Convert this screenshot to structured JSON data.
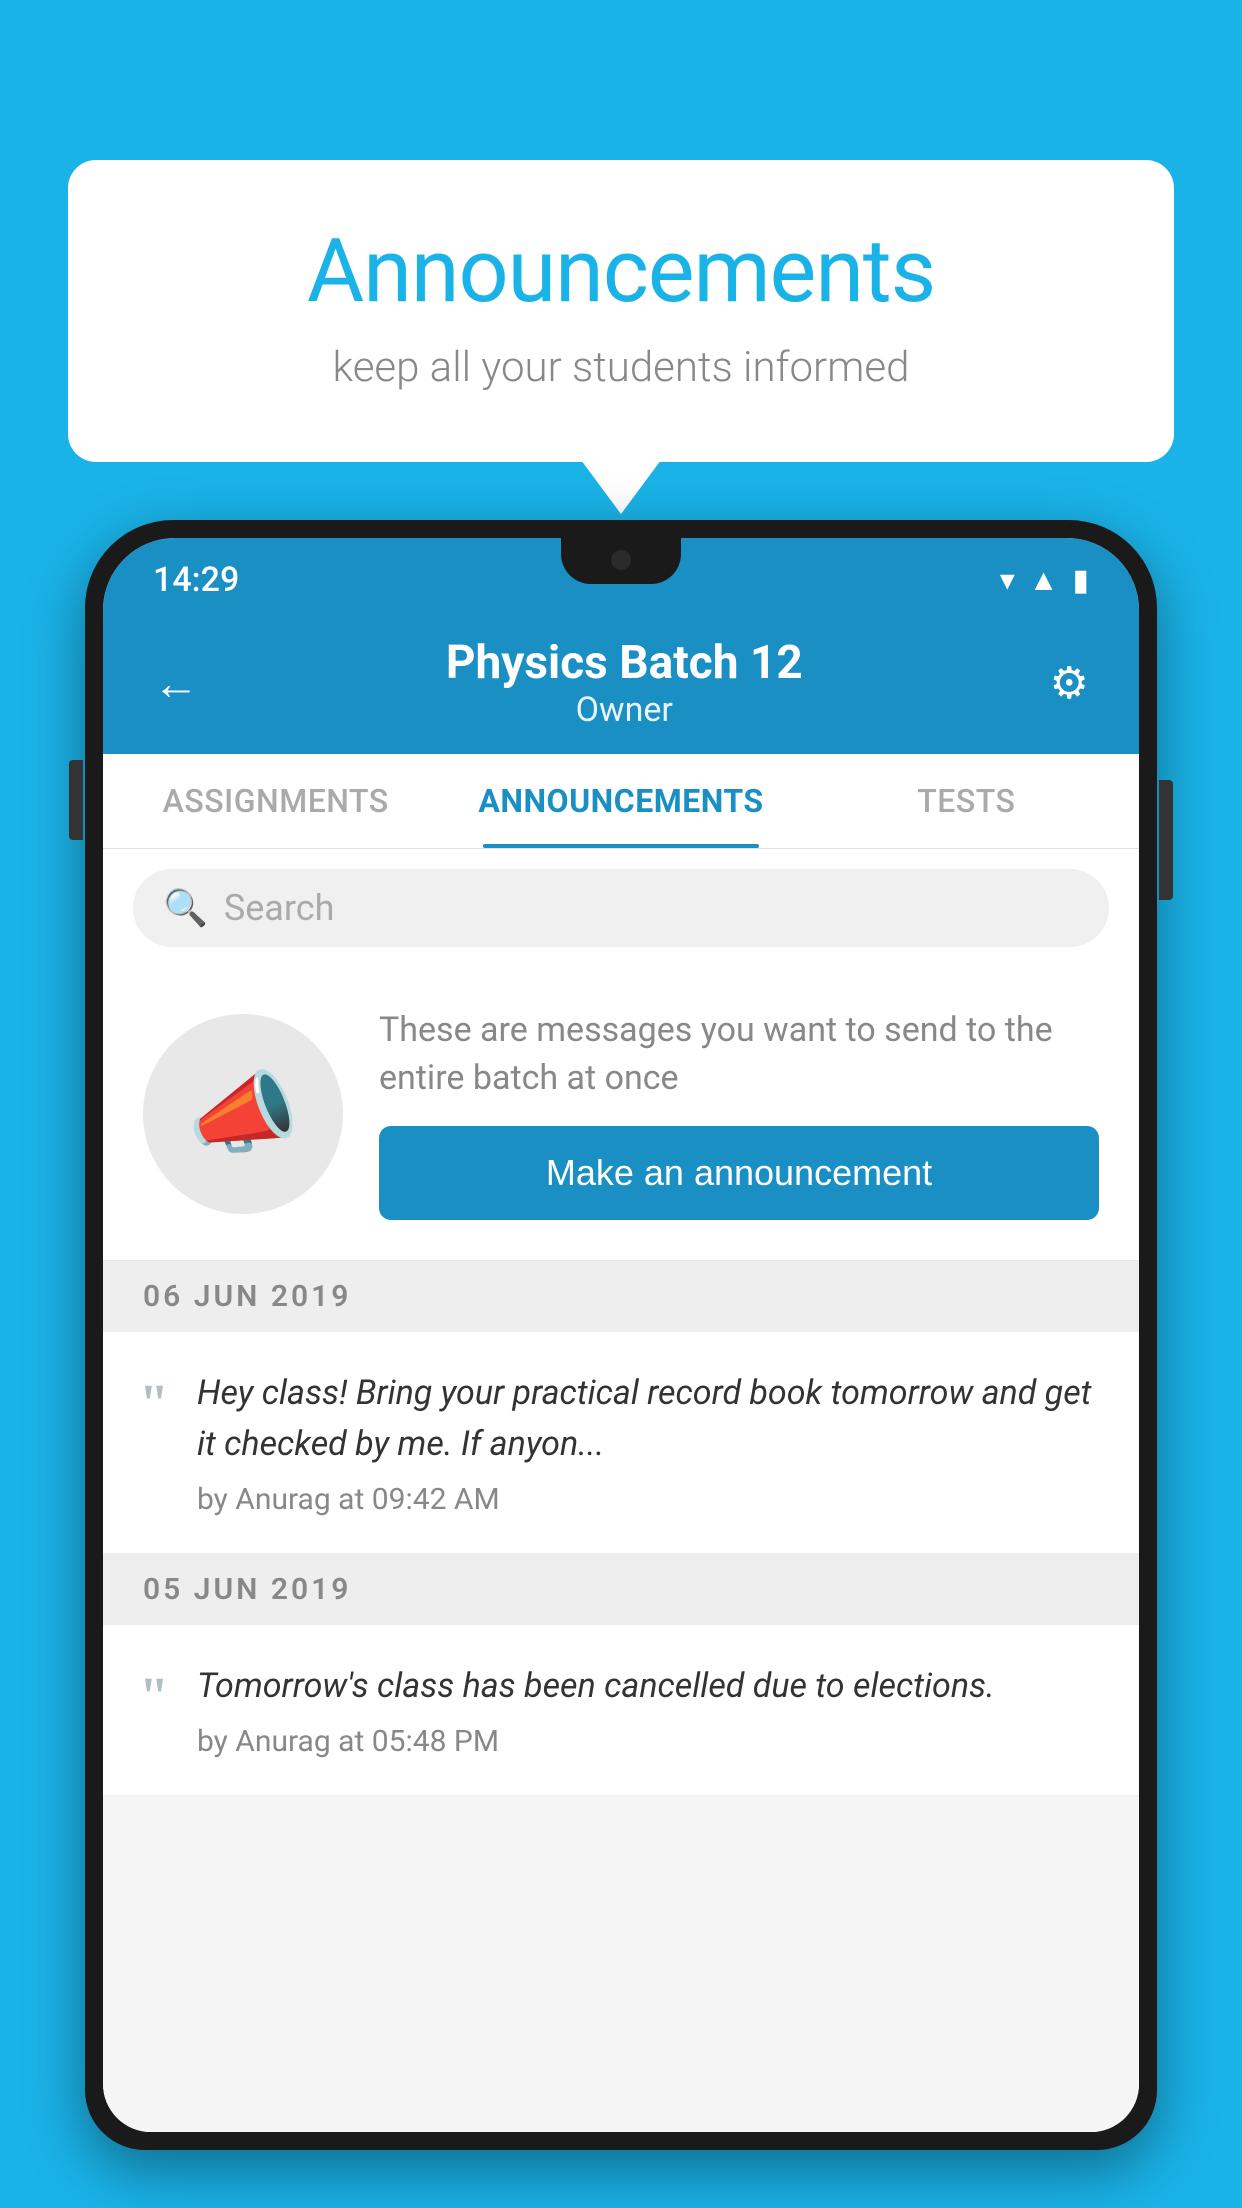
{
  "background_color": "#1ab3e8",
  "speech_bubble": {
    "title": "Announcements",
    "subtitle": "keep all your students informed"
  },
  "phone": {
    "status_bar": {
      "time": "14:29",
      "icons": [
        "wifi",
        "signal",
        "battery"
      ]
    },
    "header": {
      "back_label": "←",
      "title": "Physics Batch 12",
      "subtitle": "Owner",
      "gear_label": "⚙"
    },
    "tabs": [
      {
        "label": "ASSIGNMENTS",
        "active": false
      },
      {
        "label": "ANNOUNCEMENTS",
        "active": true
      },
      {
        "label": "TESTS",
        "active": false
      }
    ],
    "search": {
      "placeholder": "Search"
    },
    "announcement_prompt": {
      "description": "These are messages you want to send to the entire batch at once",
      "button_label": "Make an announcement"
    },
    "announcements": [
      {
        "date": "06  JUN  2019",
        "text": "Hey class! Bring your practical record book tomorrow and get it checked by me. If anyon...",
        "meta": "by Anurag at 09:42 AM"
      },
      {
        "date": "05  JUN  2019",
        "text": "Tomorrow's class has been cancelled due to elections.",
        "meta": "by Anurag at 05:48 PM"
      }
    ]
  }
}
